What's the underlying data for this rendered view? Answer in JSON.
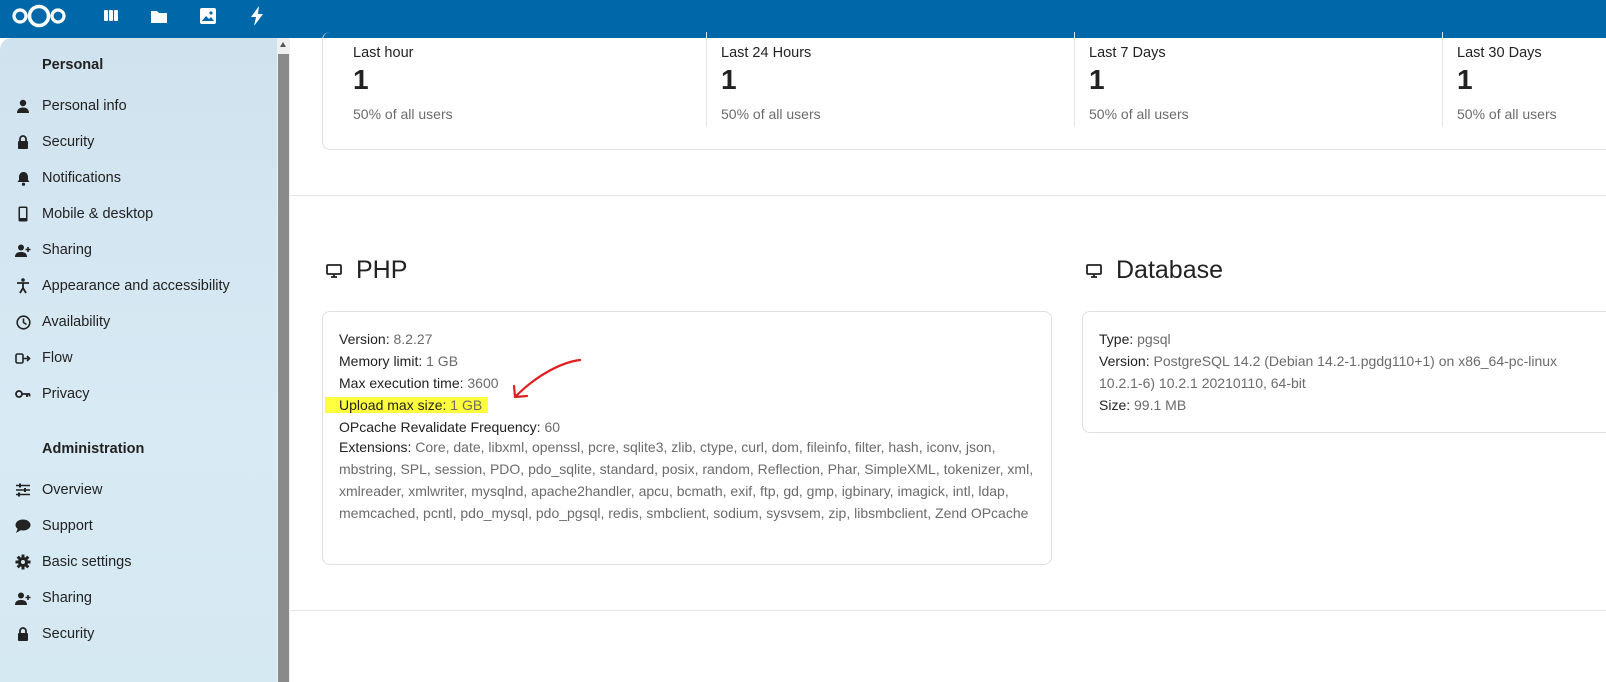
{
  "sidebar": {
    "personal_title": "Personal",
    "personal_items": [
      {
        "label": "Personal info",
        "icon": "person-icon"
      },
      {
        "label": "Security",
        "icon": "lock-icon"
      },
      {
        "label": "Notifications",
        "icon": "bell-icon"
      },
      {
        "label": "Mobile & desktop",
        "icon": "phone-icon"
      },
      {
        "label": "Sharing",
        "icon": "share-person-icon"
      },
      {
        "label": "Appearance and accessibility",
        "icon": "accessibility-icon"
      },
      {
        "label": "Availability",
        "icon": "clock-icon"
      },
      {
        "label": "Flow",
        "icon": "flow-icon"
      },
      {
        "label": "Privacy",
        "icon": "key-icon"
      }
    ],
    "admin_title": "Administration",
    "admin_items": [
      {
        "label": "Overview",
        "icon": "sliders-icon"
      },
      {
        "label": "Support",
        "icon": "chat-bubble-icon"
      },
      {
        "label": "Basic settings",
        "icon": "gear-icon"
      },
      {
        "label": "Sharing",
        "icon": "share-person-icon"
      },
      {
        "label": "Security",
        "icon": "lock-icon"
      }
    ]
  },
  "stats": [
    {
      "title": "Last hour",
      "value": "1",
      "sub": "50% of all users"
    },
    {
      "title": "Last 24 Hours",
      "value": "1",
      "sub": "50% of all users"
    },
    {
      "title": "Last 7 Days",
      "value": "1",
      "sub": "50% of all users"
    },
    {
      "title": "Last 30 Days",
      "value": "1",
      "sub": "50% of all users"
    }
  ],
  "php": {
    "title": "PHP",
    "version_label": "Version:",
    "version": "8.2.27",
    "memory_label": "Memory limit:",
    "memory": "1 GB",
    "exec_label": "Max execution time:",
    "exec": "3600",
    "upload_label": "Upload max size:",
    "upload": "1 GB",
    "opcache_label": "OPcache Revalidate Frequency:",
    "opcache": "60",
    "ext_label": "Extensions:",
    "extensions": "Core, date, libxml, openssl, pcre, sqlite3, zlib, ctype, curl, dom, fileinfo, filter, hash, iconv, json, mbstring, SPL, session, PDO, pdo_sqlite, standard, posix, random, Reflection, Phar, SimpleXML, tokenizer, xml, xmlreader, xmlwriter, mysqlnd, apache2handler, apcu, bcmath, exif, ftp, gd, gmp, igbinary, imagick, intl, ldap, memcached, pcntl, pdo_mysql, pdo_pgsql, redis, smbclient, sodium, sysvsem, zip, libsmbclient, Zend OPcache"
  },
  "database": {
    "title": "Database",
    "type_label": "Type:",
    "type": "pgsql",
    "version_label": "Version:",
    "version_line1": "PostgreSQL 14.2 (Debian 14.2-1.pgdg110+1) on x86_64-pc-linux",
    "version_line2": "10.2.1-6) 10.2.1 20210110, 64-bit",
    "size_label": "Size:",
    "size": "99.1 MB"
  },
  "colors": {
    "header": "#0068a8",
    "highlight": "#ffff3d",
    "annotation_arrow": "#e11d1d"
  }
}
